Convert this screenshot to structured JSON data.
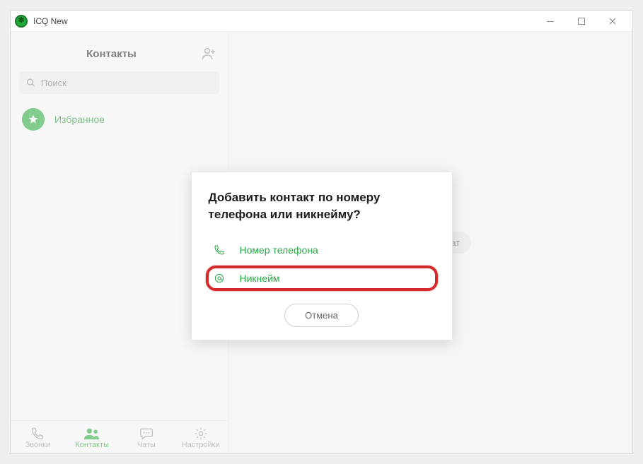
{
  "titlebar": {
    "title": "ICQ New"
  },
  "sidebar": {
    "title": "Контакты",
    "search_placeholder": "Поиск",
    "favorites_label": "Избранное"
  },
  "nav": {
    "calls": "Звонки",
    "contacts": "Контакты",
    "chats": "Чаты",
    "settings": "Настройки"
  },
  "main": {
    "select_chat": "Выберите чат"
  },
  "dialog": {
    "title": "Добавить контакт по номеру телефона или никнейму?",
    "phone_label": "Номер телефона",
    "nickname_label": "Никнейм",
    "cancel": "Отмена"
  }
}
